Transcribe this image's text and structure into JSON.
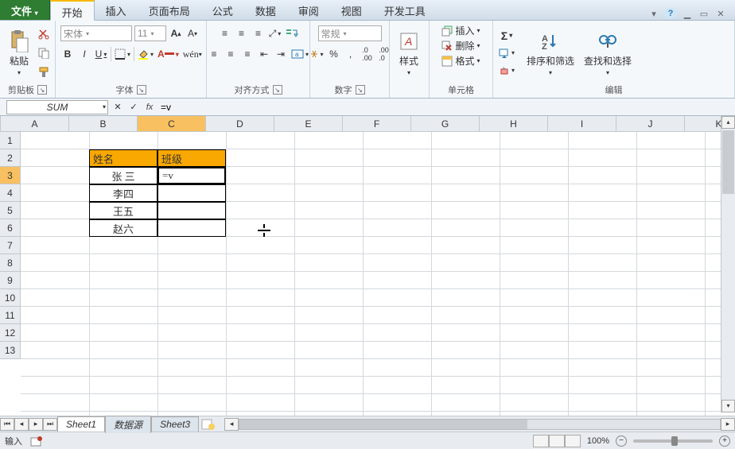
{
  "titlebar": {
    "minimize": "▁",
    "help": "?",
    "restore": "▭",
    "close": "✕",
    "caret": "▾"
  },
  "tabs": {
    "file": "文件",
    "home": "开始",
    "insert": "插入",
    "page_layout": "页面布局",
    "formulas": "公式",
    "data": "数据",
    "review": "审阅",
    "view": "视图",
    "dev": "开发工具"
  },
  "ribbon": {
    "clipboard": {
      "paste": "粘贴",
      "label": "剪贴板"
    },
    "font": {
      "name": "宋体",
      "size": "11",
      "b": "B",
      "i": "I",
      "u": "U",
      "label": "字体",
      "a_big": "A",
      "a_small": "A"
    },
    "align": {
      "label": "对齐方式",
      "general": "常规"
    },
    "number": {
      "label": "数字"
    },
    "styles": {
      "btn": "样式"
    },
    "cells": {
      "insert": "插入",
      "delete": "删除",
      "format": "格式",
      "label": "单元格"
    },
    "editing": {
      "sigma": "Σ",
      "sort": "排序和筛选",
      "find": "查找和选择",
      "label": "编辑"
    }
  },
  "namebox": {
    "value": "SUM"
  },
  "formula_bar": {
    "x": "✕",
    "check": "✓",
    "fx": "fx",
    "value": "=v"
  },
  "columns": [
    "A",
    "B",
    "C",
    "D",
    "E",
    "F",
    "G",
    "H",
    "I",
    "J",
    "K"
  ],
  "rows": [
    "1",
    "2",
    "3",
    "4",
    "5",
    "6",
    "7",
    "8",
    "9",
    "10",
    "11",
    "12",
    "13"
  ],
  "active_col": "C",
  "active_row": "3",
  "table": {
    "headers": [
      "姓名",
      "班级"
    ],
    "rows": [
      [
        "张 三",
        "=v"
      ],
      [
        "李四",
        ""
      ],
      [
        "王五",
        ""
      ],
      [
        "赵六",
        ""
      ]
    ]
  },
  "sheet_tabs": [
    "Sheet1",
    "数据源",
    "Sheet3"
  ],
  "status": {
    "mode": "输入",
    "zoom": "100%"
  }
}
